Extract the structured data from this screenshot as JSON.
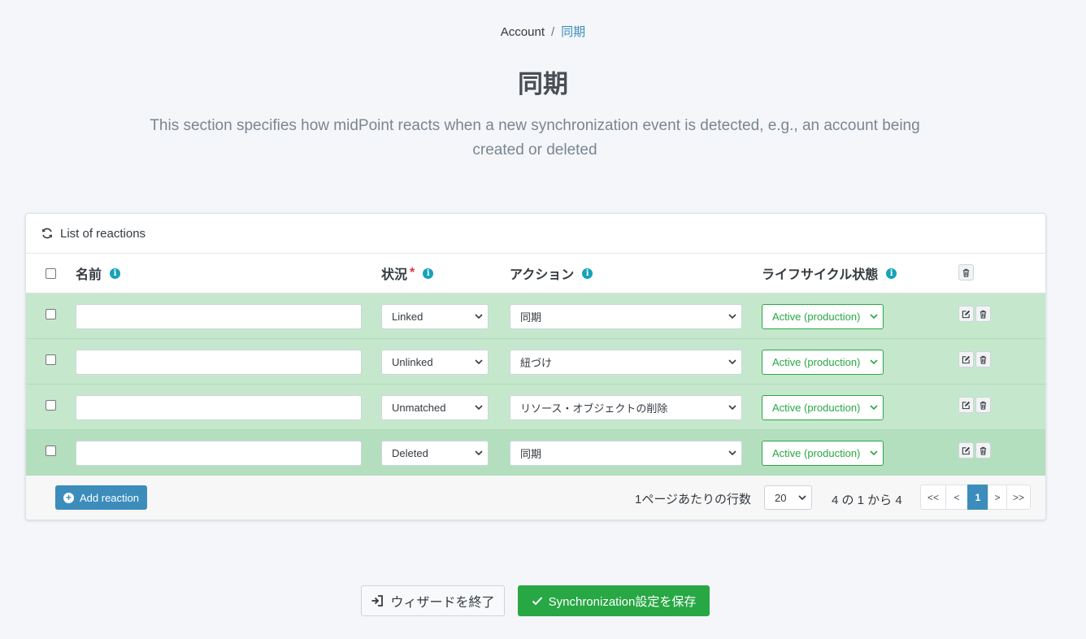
{
  "breadcrumb": {
    "parent": "Account",
    "separator": "/",
    "current": "同期"
  },
  "page": {
    "title": "同期",
    "description": "This section specifies how midPoint reacts when a new synchronization event is detected, e.g., an account being created or deleted"
  },
  "card": {
    "title": "List of reactions",
    "columns": {
      "name": "名前",
      "situation": "状況",
      "situation_required": "*",
      "action": "アクション",
      "lifecycle": "ライフサイクル状態"
    },
    "rows": [
      {
        "name_value": "",
        "situation": "Linked",
        "action": "同期",
        "lifecycle": "Active (production)"
      },
      {
        "name_value": "",
        "situation": "Unlinked",
        "action": "紐づけ",
        "lifecycle": "Active (production)"
      },
      {
        "name_value": "",
        "situation": "Unmatched",
        "action": "リソース・オブジェクトの削除",
        "lifecycle": "Active (production)"
      },
      {
        "name_value": "",
        "situation": "Deleted",
        "action": "同期",
        "lifecycle": "Active (production)"
      }
    ],
    "footer": {
      "add_label": "Add reaction",
      "rows_per_page_label": "1ページあたりの行数",
      "page_size": "20",
      "count_label": "4 の 1 から 4",
      "pager": {
        "first": "<<",
        "prev": "<",
        "current": "1",
        "next": ">",
        "last": ">>"
      }
    }
  },
  "buttons": {
    "exit": "ウィザードを終了",
    "save": "Synchronization設定を保存"
  },
  "colors": {
    "accent": "#3c8dbc",
    "success": "#28a745",
    "row_bg": "#c5e8cd",
    "info": "#17a2b8"
  },
  "icons": {
    "refresh": "refresh-icon",
    "info": "info-icon",
    "edit": "edit-icon",
    "delete": "trash-icon",
    "exit": "exit-icon",
    "check": "check-icon",
    "add": "plus-circle-icon"
  }
}
